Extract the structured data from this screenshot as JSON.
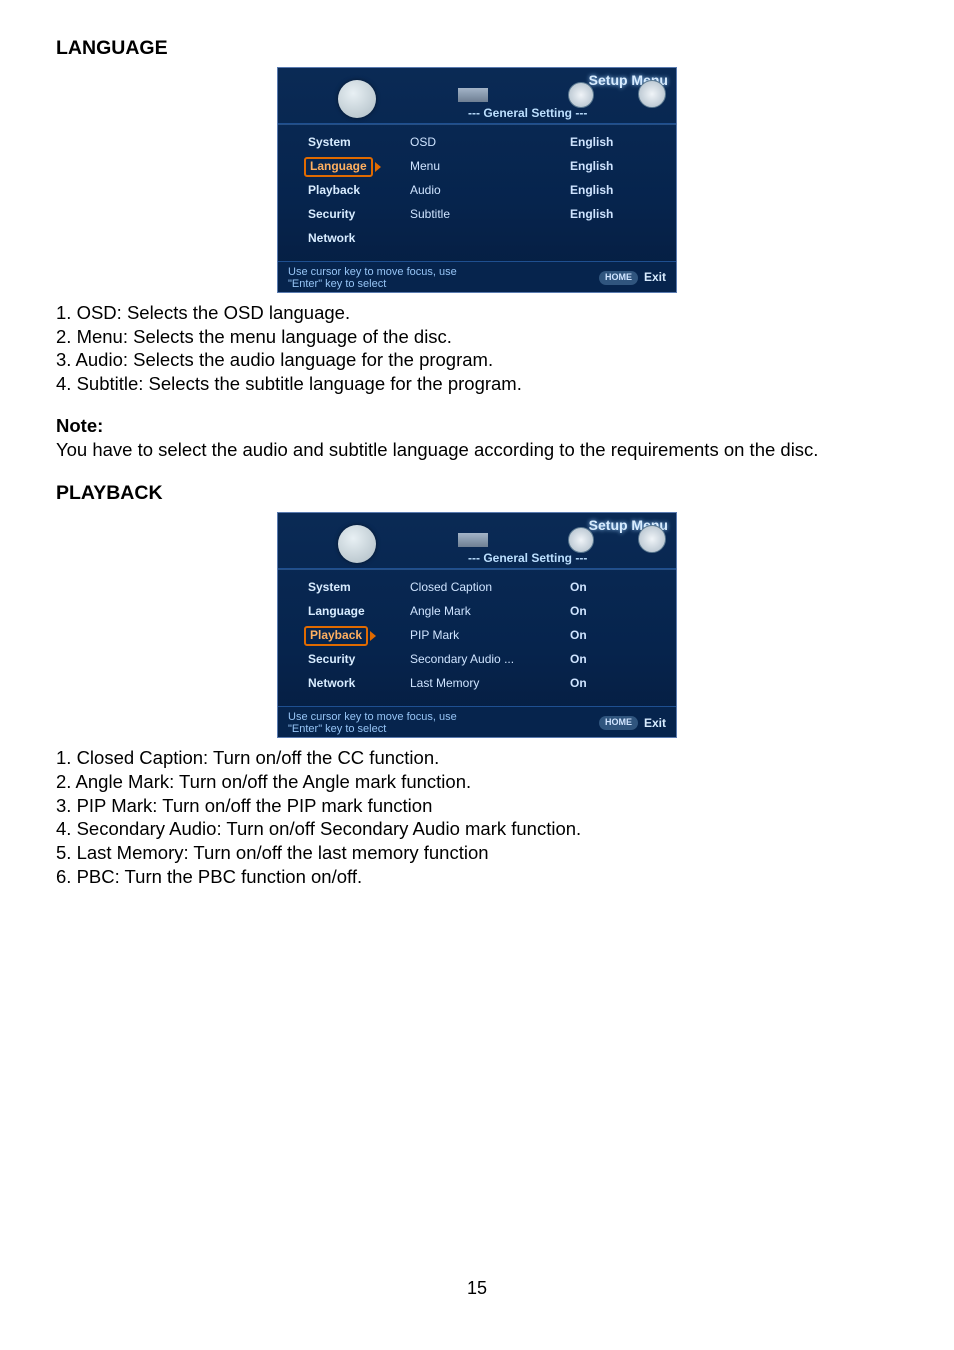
{
  "section_language_title": "LANGUAGE",
  "screenshot1": {
    "title": "Setup Menu",
    "subheader": "--- General Setting ---",
    "left_items": [
      "System",
      "Language",
      "Playback",
      "Security",
      "Network"
    ],
    "selected_index": 1,
    "mid_items": [
      "OSD",
      "Menu",
      "Audio",
      "Subtitle",
      ""
    ],
    "right_items": [
      "English",
      "English",
      "English",
      "English",
      ""
    ],
    "footer_line1": "Use cursor key to move focus, use",
    "footer_line2": "\"Enter\" key to select",
    "home_label": "HOME",
    "exit_label": "Exit"
  },
  "lang_list": [
    "1. OSD: Selects the OSD language.",
    "2. Menu: Selects the menu language of the disc.",
    "3. Audio: Selects the audio language for the program.",
    "4. Subtitle: Selects the subtitle language for the program."
  ],
  "note_heading": "Note:",
  "note_body": "You have to select the audio and subtitle language according to the requirements on the disc.",
  "section_playback_title": "PLAYBACK",
  "screenshot2": {
    "title": "Setup Menu",
    "subheader": "--- General Setting ---",
    "left_items": [
      "System",
      "Language",
      "Playback",
      "Security",
      "Network"
    ],
    "selected_index": 2,
    "mid_items": [
      "Closed Caption",
      "Angle Mark",
      "PIP Mark",
      "Secondary Audio ...",
      "Last Memory"
    ],
    "right_items": [
      "On",
      "On",
      "On",
      "On",
      "On"
    ],
    "footer_line1": "Use cursor key to move focus, use",
    "footer_line2": "\"Enter\" key to select",
    "home_label": "HOME",
    "exit_label": "Exit"
  },
  "playback_list": [
    "1. Closed Caption: Turn on/off the CC function.",
    "2. Angle Mark: Turn on/off the Angle mark function.",
    "3. PIP Mark: Turn on/off the PIP mark function",
    "4. Secondary Audio: Turn on/off Secondary Audio mark function.",
    "5. Last Memory: Turn on/off the last memory function",
    "6. PBC: Turn the PBC function on/off."
  ],
  "page_number": "15"
}
